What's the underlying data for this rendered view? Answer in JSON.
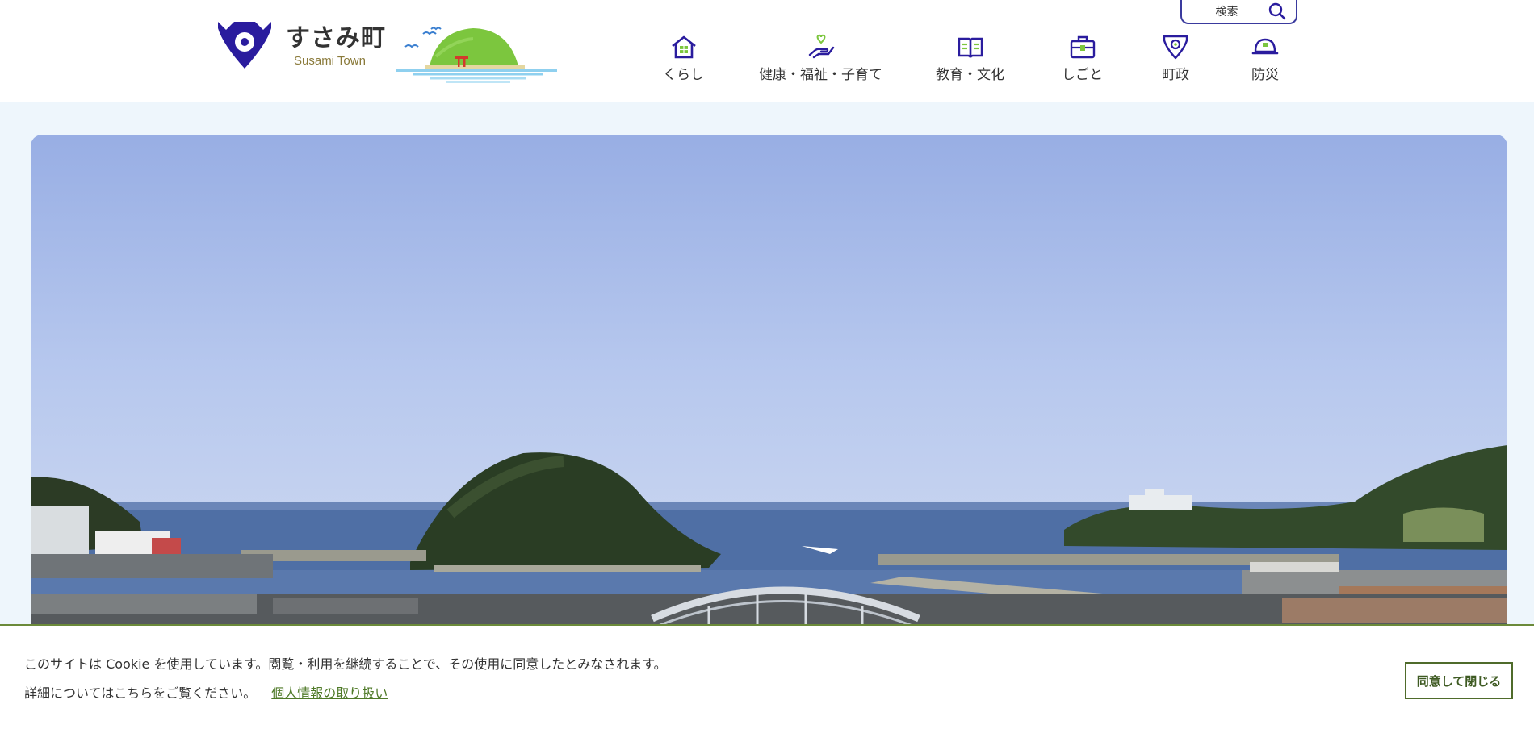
{
  "site": {
    "name_ja": "すさみ町",
    "name_en": "Susami Town"
  },
  "search": {
    "label": "検索",
    "icon": "search-icon"
  },
  "nav": {
    "items": [
      {
        "label": "くらし",
        "icon": "house-icon"
      },
      {
        "label": "健康・福祉・子育て",
        "icon": "heart-hand-icon"
      },
      {
        "label": "教育・文化",
        "icon": "open-book-icon"
      },
      {
        "label": "しごと",
        "icon": "briefcase-icon"
      },
      {
        "label": "町政",
        "icon": "town-emblem-icon"
      },
      {
        "label": "防災",
        "icon": "helmet-icon"
      }
    ]
  },
  "slider": {
    "prev_icon": "chevron-left-icon",
    "next_icon": "chevron-right-icon"
  },
  "cookie": {
    "message": "このサイトは Cookie を使用しています。閲覧・利用を継続することで、その使用に同意したとみなされます。",
    "detail": "詳細についてはこちらをご覧ください。",
    "privacy_link": "個人情報の取り扱い",
    "agree_button": "同意して閉じる"
  },
  "colors": {
    "brand": "#2a1c9e",
    "accent_green": "#7cc63e",
    "cookie_border": "#6b8a3a",
    "link": "#4f7a28"
  }
}
